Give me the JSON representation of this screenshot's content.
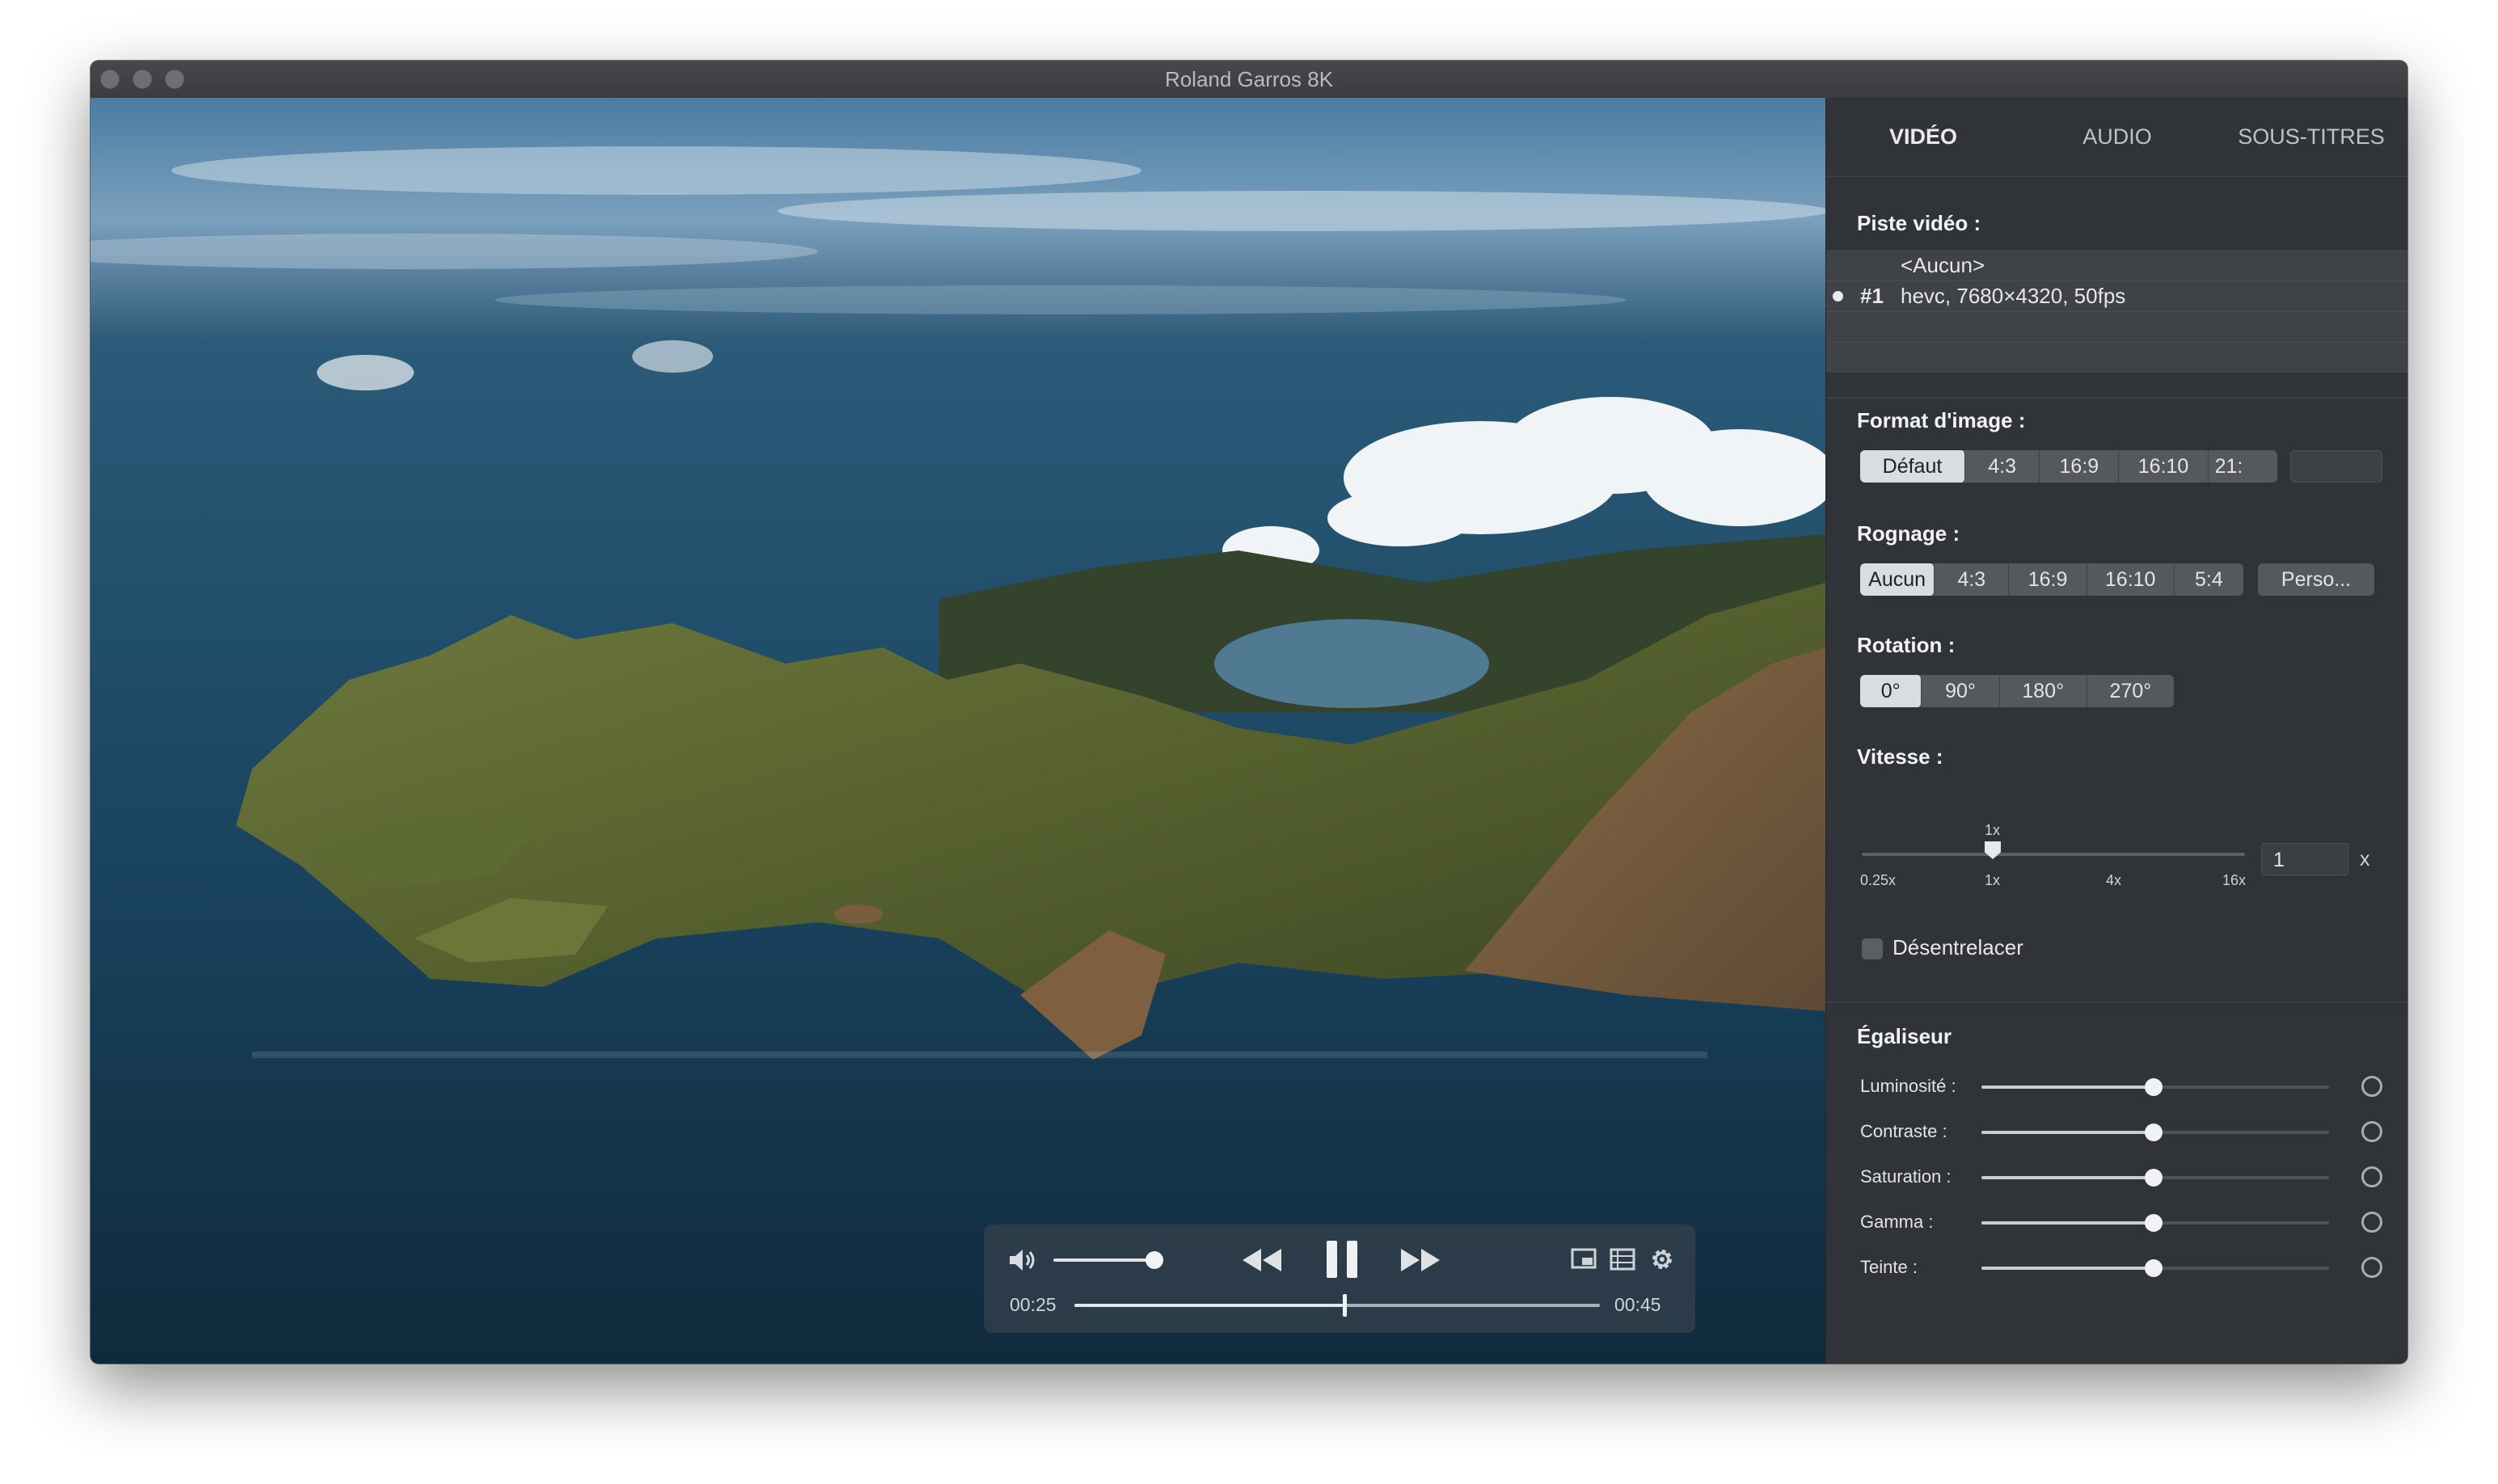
{
  "window": {
    "title": "Roland Garros 8K"
  },
  "player": {
    "current_time": "00:25",
    "duration": "00:45",
    "progress": 0.51,
    "volume": 0.85
  },
  "panel": {
    "tabs": [
      "VIDÉO",
      "AUDIO",
      "SOUS-TITRES"
    ],
    "active_tab": "VIDÉO",
    "video_track": {
      "label": "Piste vidéo :",
      "tracks": [
        {
          "id": "",
          "name": "<Aucun>",
          "selected": false
        },
        {
          "id": "#1",
          "name": "hevc, 7680×4320, 50fps",
          "selected": true
        }
      ]
    },
    "aspect": {
      "label": "Format d'image :",
      "options": [
        "Défaut",
        "4:3",
        "16:9",
        "16:10",
        "21:"
      ],
      "selected": "Défaut",
      "custom_value": ""
    },
    "crop": {
      "label": "Rognage :",
      "options": [
        "Aucun",
        "4:3",
        "16:9",
        "16:10",
        "5:4"
      ],
      "selected": "Aucun",
      "custom_button": "Perso..."
    },
    "rotation": {
      "label": "Rotation :",
      "options": [
        "0°",
        "90°",
        "180°",
        "270°"
      ],
      "selected": "0°"
    },
    "speed": {
      "label": "Vitesse :",
      "current_label": "1x",
      "ticks": [
        "0.25x",
        "1x",
        "4x",
        "16x"
      ],
      "value": "1",
      "unit": "x"
    },
    "deinterlace": {
      "label": "Désentrelacer",
      "checked": false
    },
    "equalizer": {
      "title": "Égaliseur",
      "items": [
        {
          "label": "Luminosité :",
          "value": 0.5
        },
        {
          "label": "Contraste :",
          "value": 0.5
        },
        {
          "label": "Saturation :",
          "value": 0.5
        },
        {
          "label": "Gamma :",
          "value": 0.5
        },
        {
          "label": "Teinte :",
          "value": 0.5
        }
      ]
    }
  }
}
